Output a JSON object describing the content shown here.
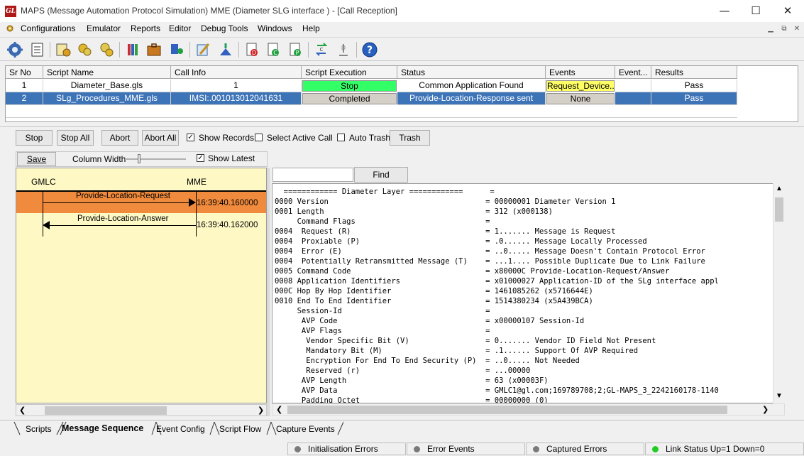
{
  "window": {
    "title": "MAPS (Message Automation Protocol Simulation) MME (Diameter SLG interface ) - [Call Reception]",
    "logo_text": "GL"
  },
  "menu": [
    "Configurations",
    "Emulator",
    "Reports",
    "Editor",
    "Debug Tools",
    "Windows",
    "Help"
  ],
  "grid": {
    "columns": [
      "Sr No",
      "Script Name",
      "Call Info",
      "Script Execution",
      "Status",
      "Events",
      "Event...",
      "Results"
    ],
    "rows": [
      {
        "sr": "1",
        "script": "Diameter_Base.gls",
        "call_info": "1",
        "execution": "Stop",
        "status": "Common Application Found",
        "events": "Request_Device...",
        "event2": "",
        "result": "Pass"
      },
      {
        "sr": "2",
        "script": "SLg_Procedures_MME.gls",
        "call_info": "IMSI:.001013012041631",
        "execution": "Completed",
        "status": "Provide-Location-Response sent",
        "events": "None",
        "event2": "",
        "result": "Pass"
      }
    ]
  },
  "controls": {
    "stop": "Stop",
    "stop_all": "Stop All",
    "abort": "Abort",
    "abort_all": "Abort All",
    "show_records": "Show Records",
    "select_active_call": "Select Active Call",
    "auto_trash": "Auto Trash",
    "trash": "Trash"
  },
  "seqbar": {
    "save": "Save",
    "column_width": "Column Width",
    "show_latest": "Show Latest"
  },
  "sequence": {
    "entities": [
      "GMLC",
      "MME"
    ],
    "messages": [
      {
        "label": "Provide-Location-Request",
        "time": "16:39:40.160000",
        "direction": "right",
        "highlight": true
      },
      {
        "label": "Provide-Location-Answer",
        "time": "16:39:40.162000",
        "direction": "left",
        "highlight": false
      }
    ]
  },
  "find": {
    "button": "Find",
    "value": ""
  },
  "decode": [
    "  ============ Diameter Layer ============      =",
    "0000 Version                                   = 00000001 Diameter Version 1",
    "0001 Length                                    = 312 (x000138)",
    "     Command Flags                             =",
    "0004  Request (R)                              = 1....... Message is Request",
    "0004  Proxiable (P)                            = .0...... Message Locally Processed",
    "0004  Error (E)                                = ..0..... Message Doesn't Contain Protocol Error",
    "0004  Potentially Retransmitted Message (T)    = ...1.... Possible Duplicate Due to Link Failure",
    "0005 Command Code                              = x80000C Provide-Location-Request/Answer",
    "0008 Application Identifiers                   = x01000027 Application-ID of the SLg interface appl",
    "000C Hop By Hop Identifier                     = 1461085262 (x5716644E)",
    "0010 End To End Identifier                     = 1514380234 (x5A439BCA)",
    "     Session-Id                                =",
    "      AVP Code                                 = x00000107 Session-Id",
    "      AVP Flags                                =",
    "       Vendor Specific Bit (V)                 = 0....... Vendor ID Field Not Present",
    "       Mandatory Bit (M)                       = .1...... Support Of AVP Required",
    "       Encryption For End To End Security (P)  = ..0..... Not Needed",
    "       Reserved (r)                            = ...00000",
    "      AVP Length                               = 63 (x00003F)",
    "      AVP Data                                 = GMLC1@gl.com;169789708;2;GL-MAPS_3_2242160178-1140",
    "      Padding Octet                            = 00000000 (0)"
  ],
  "tabs": [
    "Scripts",
    "Message Sequence",
    "Event Config",
    "Script Flow",
    "Capture Events"
  ],
  "status_bar": [
    {
      "label": "Initialisation Errors",
      "color": "#7a7a7a"
    },
    {
      "label": "Error Events",
      "color": "#7a7a7a"
    },
    {
      "label": "Captured Errors",
      "color": "#7a7a7a"
    },
    {
      "label": "Link Status Up=1 Down=0",
      "color": "#22cc22"
    }
  ],
  "colors": {
    "stop_green": "#33ff66",
    "events_yellow": "#ffff66",
    "selected_row": "#3d74b8",
    "highlight_orange": "#f08a3c",
    "seq_bg": "#fdf8c4"
  }
}
